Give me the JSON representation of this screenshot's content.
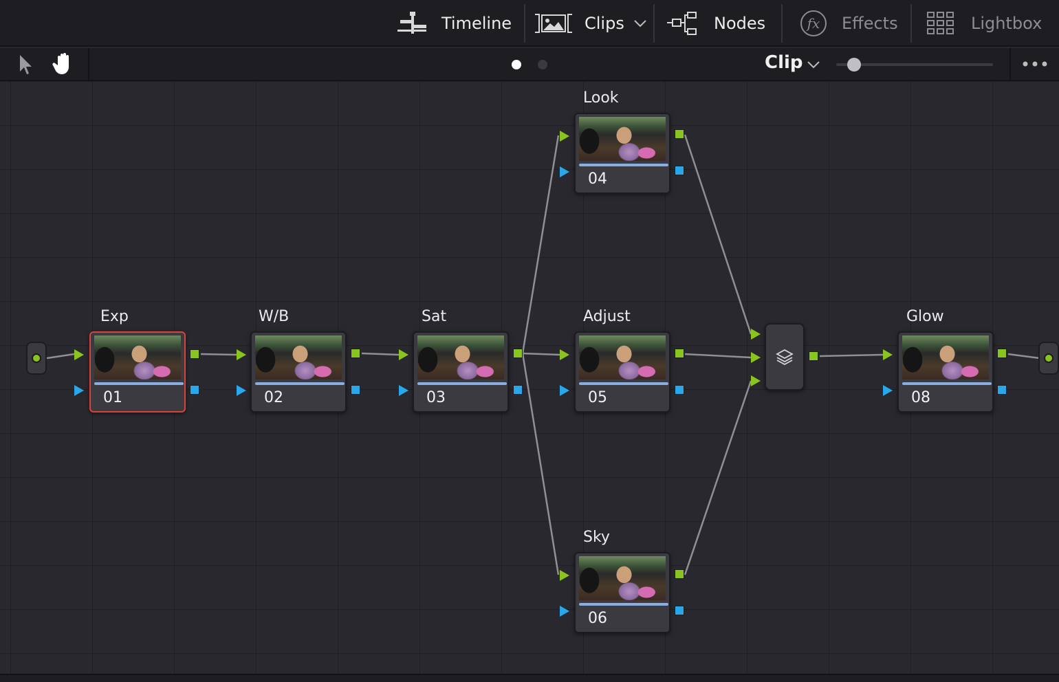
{
  "toolbar": {
    "timeline": {
      "label": "Timeline",
      "icon": "timeline-icon"
    },
    "clips": {
      "label": "Clips",
      "icon": "clips-icon"
    },
    "nodes": {
      "label": "Nodes",
      "icon": "nodes-icon"
    },
    "effects": {
      "label": "Effects",
      "icon": "fx-icon"
    },
    "lightbox": {
      "label": "Lightbox",
      "icon": "lightbox-icon"
    }
  },
  "subbar": {
    "mode_label": "Clip",
    "zoom_level": 0.07,
    "pager_count": 2,
    "pager_active": 0
  },
  "colors": {
    "green_port": "#8ac41e",
    "blue_port": "#2aa7e8",
    "selected_border": "#d9443a",
    "canvas_bg": "#28282e"
  },
  "nodes": [
    {
      "id": "01",
      "title": "Exp",
      "selected": true
    },
    {
      "id": "02",
      "title": "W/B",
      "selected": false
    },
    {
      "id": "03",
      "title": "Sat",
      "selected": false
    },
    {
      "id": "04",
      "title": "Look",
      "selected": false
    },
    {
      "id": "05",
      "title": "Adjust",
      "selected": false
    },
    {
      "id": "06",
      "title": "Sky",
      "selected": false
    },
    {
      "id": "08",
      "title": "Glow",
      "selected": false
    }
  ],
  "layer_mixer": {
    "icon": "layers-icon"
  }
}
